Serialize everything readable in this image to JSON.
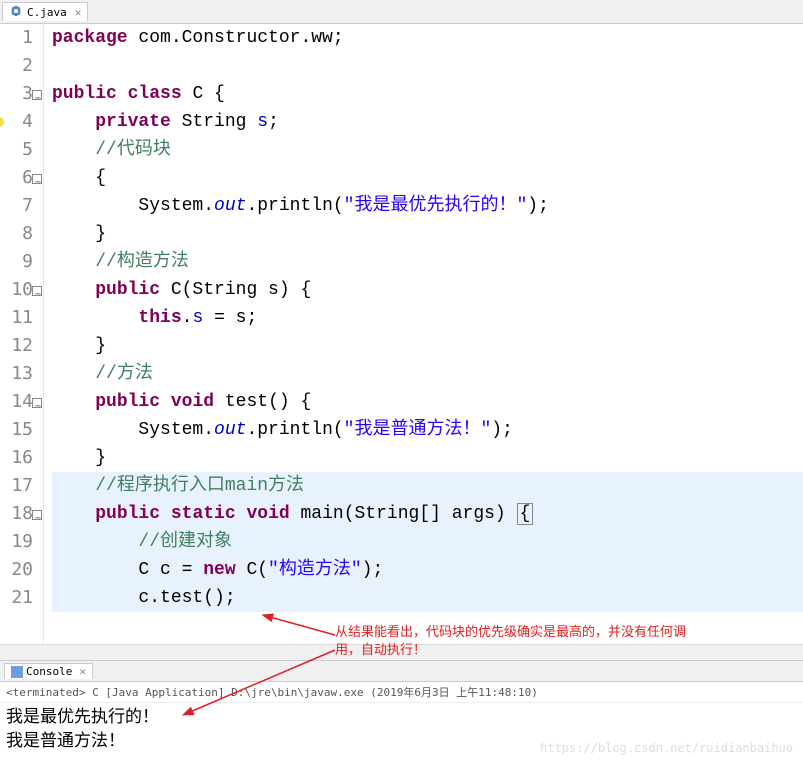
{
  "tab": {
    "filename": "C.java"
  },
  "gutter": {
    "lines": [
      1,
      2,
      3,
      4,
      5,
      6,
      7,
      8,
      9,
      10,
      11,
      12,
      13,
      14,
      15,
      16,
      17,
      18,
      19,
      20,
      21
    ],
    "fold_at": [
      3,
      6,
      10,
      14,
      18
    ],
    "warn_at": [
      4
    ],
    "highlight_block_start": 17,
    "highlight_block_end": 21
  },
  "code": {
    "l1_kw1": "package",
    "l1_rest": " com.Constructor.ww;",
    "l3_kw1": "public",
    "l3_kw2": "class",
    "l3_rest": " C {",
    "l4_kw1": "private",
    "l4_type": " String ",
    "l4_fld": "s",
    "l4_end": ";",
    "l5_cm": "//代码块",
    "l6": "{",
    "l7_a": "System.",
    "l7_out": "out",
    "l7_b": ".println(",
    "l7_str": "\"我是最优先执行的！\"",
    "l7_c": ");",
    "l8": "}",
    "l9_cm": "//构造方法",
    "l10_kw": "public",
    "l10_rest": " C(String s) {",
    "l11_kw": "this",
    "l11_a": ".",
    "l11_fld": "s",
    "l11_b": " = s;",
    "l12": "}",
    "l13_cm": "//方法",
    "l14_kw1": "public",
    "l14_kw2": "void",
    "l14_rest": " test() {",
    "l15_a": "System.",
    "l15_out": "out",
    "l15_b": ".println(",
    "l15_str": "\"我是普通方法！\"",
    "l15_c": ");",
    "l16": "}",
    "l17_cm": "//程序执行入口main方法",
    "l18_kw1": "public",
    "l18_kw2": "static",
    "l18_kw3": "void",
    "l18_rest": " main(String[] args) ",
    "l18_brace": "{",
    "l19_cm": "//创建对象",
    "l20_a": "C c = ",
    "l20_kw": "new",
    "l20_b": " C(",
    "l20_str": "\"构造方法\"",
    "l20_c": ");",
    "l21": "c.test();"
  },
  "console": {
    "tab_label": "Console",
    "status": "<terminated> C [Java Application] D:\\jre\\bin\\javaw.exe (2019年6月3日 上午11:48:10)",
    "line1": "我是最优先执行的！",
    "line2": "我是普通方法！"
  },
  "annotation": {
    "text1": "从结果能看出，代码块的优先级确实是最高的，并没有任何调",
    "text2": "用，自动执行！"
  },
  "watermark": "https://blog.csdn.net/ruidianbaihuo"
}
